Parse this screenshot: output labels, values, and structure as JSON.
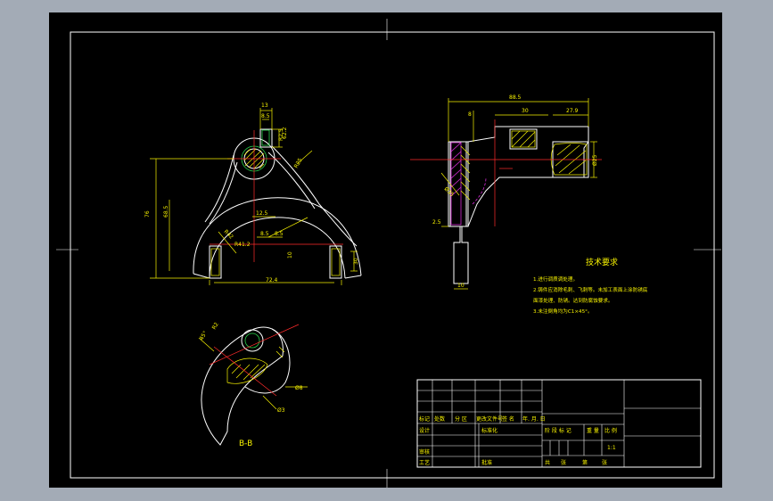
{
  "drawing": {
    "dimensions": {
      "front": [
        "13",
        "8.5",
        "R2.5",
        "R25",
        "62.2",
        "68.5",
        "76",
        "12.5",
        "R42",
        "8.5",
        "8.5",
        "R41.2",
        "10",
        "30",
        "72.4"
      ],
      "side": [
        "88.5",
        "8",
        "30",
        "27.9",
        "Ø25",
        "Ø35",
        "2.5",
        "10"
      ],
      "section": [
        "45°",
        "R2",
        "Ø8",
        "Ø3"
      ]
    },
    "tech_req_title": "技术要求",
    "tech_req_lines": [
      "1.进行调质调处理。",
      "2.铸件应消除毛刺、飞刺等。未加工表面上涂防锈底",
      "面漆处理、防锈。达到防腐蚀要求。",
      "3.未注倒角均为C1×45°。"
    ],
    "section_label": "B-B",
    "title_block": {
      "header_cells": [
        "标记",
        "处数",
        "分 区",
        "更改文件号",
        "签 名",
        "年. 月. 日"
      ],
      "row_design": [
        "设计",
        "标准化"
      ],
      "row_review": "审核",
      "row_process": [
        "工艺",
        "批准"
      ],
      "stage_header": [
        "阶 段 标 记",
        "重 量",
        "比 例"
      ],
      "scale": "1:1",
      "sheets": [
        "共",
        "张",
        "第",
        "张"
      ]
    }
  }
}
